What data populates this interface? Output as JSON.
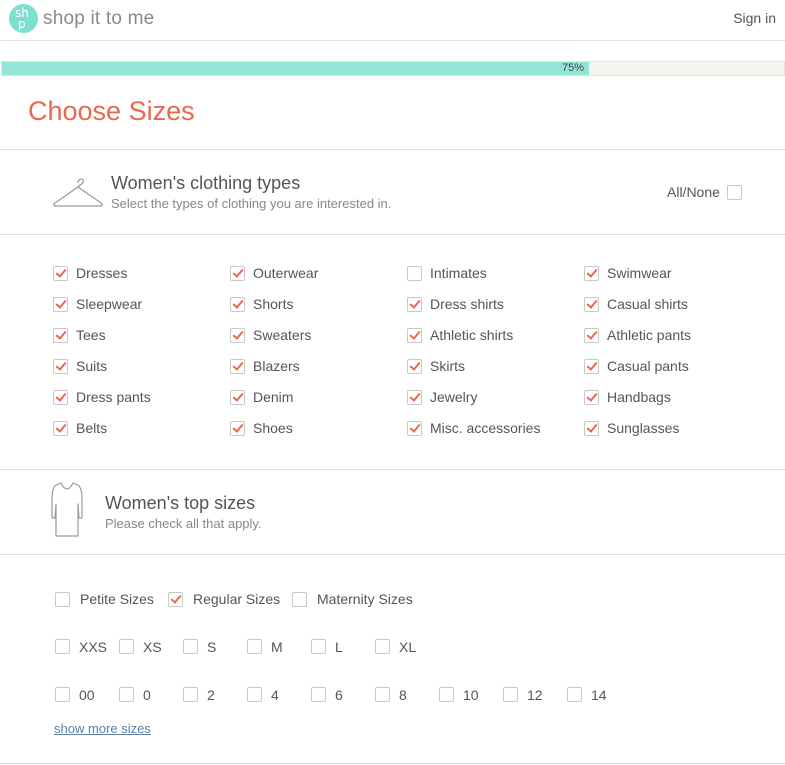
{
  "header": {
    "logo_line1": "sh",
    "logo_line2": "p",
    "logo_text": "shop it to me",
    "signin": "Sign in"
  },
  "progress": {
    "label": "75%",
    "percent": 75
  },
  "page_title": "Choose Sizes",
  "clothing": {
    "title": "Women's clothing types",
    "subtitle": "Select the types of clothing you are interested in.",
    "all_none": "All/None",
    "all_none_checked": false,
    "columns": [
      [
        {
          "label": "Dresses",
          "checked": true
        },
        {
          "label": "Sleepwear",
          "checked": true
        },
        {
          "label": "Tees",
          "checked": true
        },
        {
          "label": "Suits",
          "checked": true
        },
        {
          "label": "Dress pants",
          "checked": true
        },
        {
          "label": "Belts",
          "checked": true
        }
      ],
      [
        {
          "label": "Outerwear",
          "checked": true
        },
        {
          "label": "Shorts",
          "checked": true
        },
        {
          "label": "Sweaters",
          "checked": true
        },
        {
          "label": "Blazers",
          "checked": true
        },
        {
          "label": "Denim",
          "checked": true
        },
        {
          "label": "Shoes",
          "checked": true
        }
      ],
      [
        {
          "label": "Intimates",
          "checked": false
        },
        {
          "label": "Dress shirts",
          "checked": true
        },
        {
          "label": "Athletic shirts",
          "checked": true
        },
        {
          "label": "Skirts",
          "checked": true
        },
        {
          "label": "Jewelry",
          "checked": true
        },
        {
          "label": "Misc. accessories",
          "checked": true
        }
      ],
      [
        {
          "label": "Swimwear",
          "checked": true
        },
        {
          "label": "Casual shirts",
          "checked": true
        },
        {
          "label": "Athletic pants",
          "checked": true
        },
        {
          "label": "Casual pants",
          "checked": true
        },
        {
          "label": "Handbags",
          "checked": true
        },
        {
          "label": "Sunglasses",
          "checked": true
        }
      ]
    ]
  },
  "tops": {
    "title": "Women's top sizes",
    "subtitle": "Please check all that apply.",
    "categories": [
      {
        "label": "Petite Sizes",
        "checked": false
      },
      {
        "label": "Regular Sizes",
        "checked": true
      },
      {
        "label": "Maternity Sizes",
        "checked": false
      }
    ],
    "letter_sizes": [
      {
        "label": "XXS",
        "checked": false
      },
      {
        "label": "XS",
        "checked": false
      },
      {
        "label": "S",
        "checked": false
      },
      {
        "label": "M",
        "checked": false
      },
      {
        "label": "L",
        "checked": false
      },
      {
        "label": "XL",
        "checked": false
      }
    ],
    "number_sizes": [
      {
        "label": "00",
        "checked": false
      },
      {
        "label": "0",
        "checked": false
      },
      {
        "label": "2",
        "checked": false
      },
      {
        "label": "4",
        "checked": false
      },
      {
        "label": "6",
        "checked": false
      },
      {
        "label": "8",
        "checked": false
      },
      {
        "label": "10",
        "checked": false
      },
      {
        "label": "12",
        "checked": false
      },
      {
        "label": "14",
        "checked": false
      }
    ],
    "show_more": "show more sizes"
  },
  "colors": {
    "accent": "#e8674f",
    "teal": "#7ddfd0",
    "progress_fill": "#93e6d7"
  },
  "icons": {
    "logo": "shopittome-logo-icon",
    "hanger": "hanger-icon",
    "top": "shirt-icon"
  }
}
